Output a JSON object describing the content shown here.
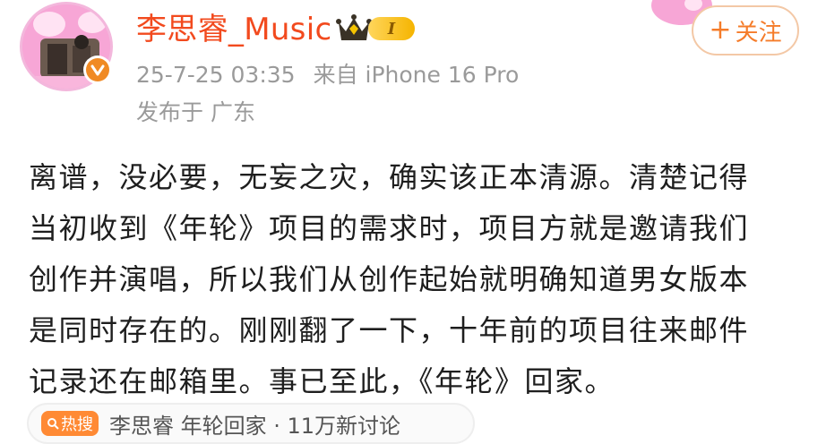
{
  "user": {
    "name": "李思睿_Music",
    "level": "I",
    "timestamp": "25-7-25 03:35",
    "source": "来自 iPhone 16 Pro",
    "location": "发布于 广东"
  },
  "follow_button": {
    "plus": "+",
    "label": "关注"
  },
  "post": {
    "lines": [
      "离谱，没必要，无妄之灾，确实该正本清源。清楚记得",
      "当初收到《年轮》项目的需求时，项目方就是邀请我们",
      "创作并演唱，所以我们从创作起始就明确知道男女版本",
      "是同时存在的。刚刚翻了一下，十年前的项目往来邮件",
      "记录还在邮箱里。事已至此，《年轮》回家。"
    ]
  },
  "topic": {
    "tag": "热搜",
    "text": "李思睿 年轮回家 · 11万新讨论"
  },
  "colors": {
    "accent": "#f57c2a",
    "username": "#f24a1e",
    "meta": "#9a9a9a",
    "text": "#1e1e1e"
  }
}
